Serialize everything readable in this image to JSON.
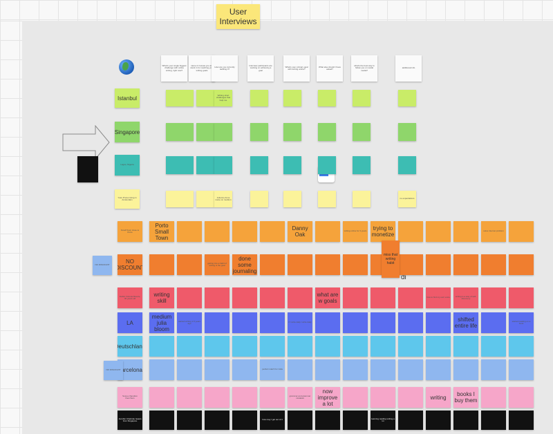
{
  "board": {
    "title": "User Interviews",
    "colors": {
      "yellow": "#fbf19d",
      "lime": "#c9ec68",
      "green": "#8fd66b",
      "teal": "#3dbdb3",
      "lightyellow": "#fbf39a",
      "orange": "#f5a33b",
      "deeporange": "#f07e2f",
      "red": "#ef5a6a",
      "blue": "#5b6df0",
      "lightblue": "#5ec7ec",
      "skyblue": "#8fb7ef",
      "pink": "#f6a6c9",
      "black": "#111111",
      "white": "#fafafa"
    }
  },
  "header_row": {
    "questions": [
      "What's your single biggest challenge with online writing, right now?",
      "name 2-3 areas you are stuck in for reaching your writing goals",
      "How are you currently tackling it?",
      "Interview participants are working on achieving a goal",
      "What's your primary goal with writing online?",
      "What else should I have asked?",
      "what's the best way to follow you on social media?",
      "additional info"
    ]
  },
  "rows": [
    {
      "label": "Istanbul",
      "color": "#c9ec68",
      "kind": "short",
      "notes": [
        "",
        "",
        "Writing short challenges that help me",
        "",
        "",
        "",
        "",
        ""
      ]
    },
    {
      "label": "Singapore",
      "color": "#8fd66b",
      "kind": "short",
      "notes": [
        "",
        "",
        "",
        "",
        "",
        "",
        "",
        ""
      ]
    },
    {
      "label": "Lagos, Nigeria",
      "color": "#3dbdb3",
      "kind": "short",
      "notes": [
        "",
        "",
        "",
        "",
        "",
        "",
        "",
        ""
      ]
    },
    {
      "label": "Yoav Pruner living in Amsterdam",
      "color": "#fbf39a",
      "kind": "short",
      "notes": [
        "",
        "",
        "Julienne Anne name on medium",
        "",
        "",
        "",
        "",
        "no expectations"
      ]
    },
    {
      "label": "Small Town close to Porto",
      "color": "#f5a33b",
      "notes": [
        "Porto Small Town",
        "",
        "",
        "",
        "",
        "Danny Oak",
        "",
        "writing online for 3 years",
        "trying to monetize",
        "",
        "",
        "",
        "solve internet problem",
        ""
      ]
    },
    {
      "label": "NO DISCOUNT",
      "color": "#f07e2f",
      "notes": [
        "",
        "",
        "getting into a habit of writing is the goal",
        "done some journaling",
        "",
        "",
        "",
        "",
        "",
        "",
        "",
        "",
        "",
        ""
      ]
    },
    {
      "label": "Dublin Victoria Muscle, 46 years old",
      "color": "#ef5a6a",
      "notes": [
        "writing skill",
        "",
        "",
        "",
        "",
        "",
        "what are w goals",
        "",
        "",
        "",
        "how to find my own voice",
        "writing is a way of self-discovery",
        "",
        ""
      ]
    },
    {
      "label": "LA",
      "color": "#5b6df0",
      "notes": [
        "medium julia bloom",
        "started writing 1.5 years ago",
        "",
        "",
        "",
        "if I write daily I write daily",
        "",
        "",
        "",
        "",
        "",
        "shifted entire life",
        "",
        "started reading on a book"
      ]
    },
    {
      "label": "Deutschland",
      "color": "#5ec7ec",
      "notes": [
        "",
        "",
        "",
        "",
        "",
        "",
        "",
        "",
        "",
        "",
        "",
        "",
        "",
        ""
      ]
    },
    {
      "label": "Barcelona",
      "color": "#8fb7ef",
      "notes": [
        "",
        "",
        "",
        "",
        "perfect match for Julia",
        "",
        "",
        "",
        "",
        "",
        "",
        "",
        "",
        ""
      ]
    },
    {
      "label": "Sussu chandran them/hers",
      "color": "#f6a6c9",
      "notes": [
        "",
        "",
        "",
        "",
        "",
        "grammar and grammar mistakes",
        "now improve a lot",
        "",
        "",
        "",
        "writing",
        "books I buy them",
        "",
        ""
      ]
    },
    {
      "label": "Jennifer Charlotte Isaacs from Singapore",
      "color": "#111111",
      "notes": [
        "",
        "",
        "",
        "",
        "how may I get out of it",
        "",
        "",
        "",
        "learning reading writing a lot",
        "",
        "",
        "",
        "",
        ""
      ]
    }
  ],
  "side_labels": {
    "no_discount_1": "NO DISCOUNT",
    "no_discount_2": "NO DISCOUNT",
    "lonely_note": "miss that writing habit",
    "di": "di"
  }
}
